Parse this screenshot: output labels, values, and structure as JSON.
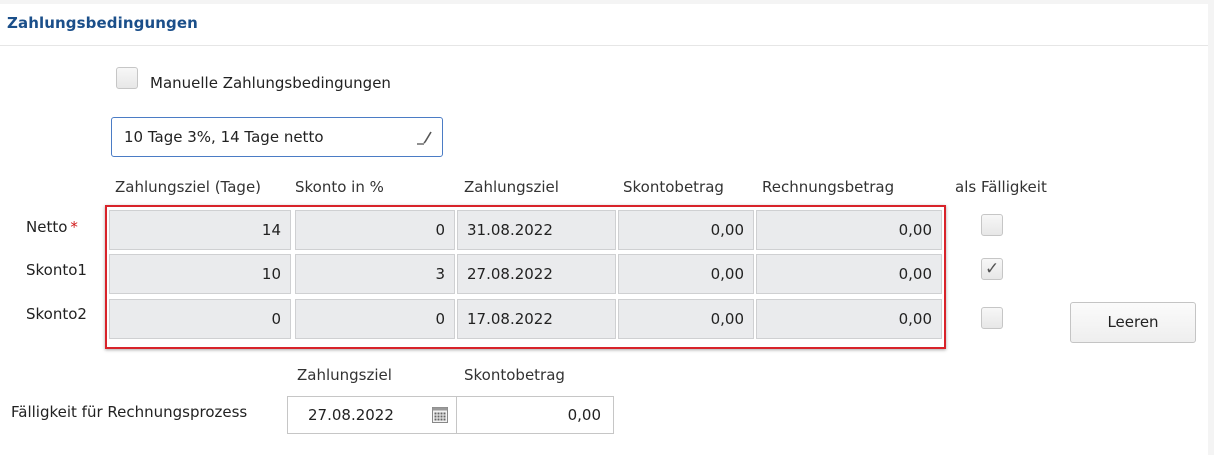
{
  "section": {
    "title": "Zahlungsbedingungen"
  },
  "manual": {
    "label": "Manuelle Zahlungsbedingungen",
    "checked": false
  },
  "terms_select": {
    "value": "10 Tage 3%, 14 Tage netto",
    "icon": "pencil-icon"
  },
  "table": {
    "headers": {
      "zahlungsziel_tage": "Zahlungsziel (Tage)",
      "skonto_pct": "Skonto in %",
      "zahlungsziel": "Zahlungsziel",
      "skontobetrag": "Skontobetrag",
      "rechnungsbetrag": "Rechnungsbetrag",
      "als_faelligkeit": "als Fälligkeit"
    },
    "rows": [
      {
        "label": "Netto",
        "required": "*",
        "tage": "14",
        "skonto": "0",
        "datum": "31.08.2022",
        "skontobetrag": "0,00",
        "rechnungsbetrag": "0,00",
        "als_faelligkeit": false
      },
      {
        "label": "Skonto1",
        "tage": "10",
        "skonto": "3",
        "datum": "27.08.2022",
        "skontobetrag": "0,00",
        "rechnungsbetrag": "0,00",
        "als_faelligkeit": true
      },
      {
        "label": "Skonto2",
        "tage": "0",
        "skonto": "0",
        "datum": "17.08.2022",
        "skontobetrag": "0,00",
        "rechnungsbetrag": "0,00",
        "als_faelligkeit": false
      }
    ]
  },
  "clear_button": {
    "label": "Leeren"
  },
  "faelligkeit": {
    "label": "Fälligkeit für Rechnungsprozess",
    "header_zahlungsziel": "Zahlungsziel",
    "header_skontobetrag": "Skontobetrag",
    "zahlungsziel": "27.08.2022",
    "skontobetrag": "0,00",
    "icon": "calendar-icon"
  },
  "colors": {
    "title_blue": "#1b4f8a",
    "highlight_red": "#d8232a",
    "cell_gray": "#eaebed",
    "focus_blue": "#4b7cc5",
    "required_red": "#d11a1a"
  }
}
